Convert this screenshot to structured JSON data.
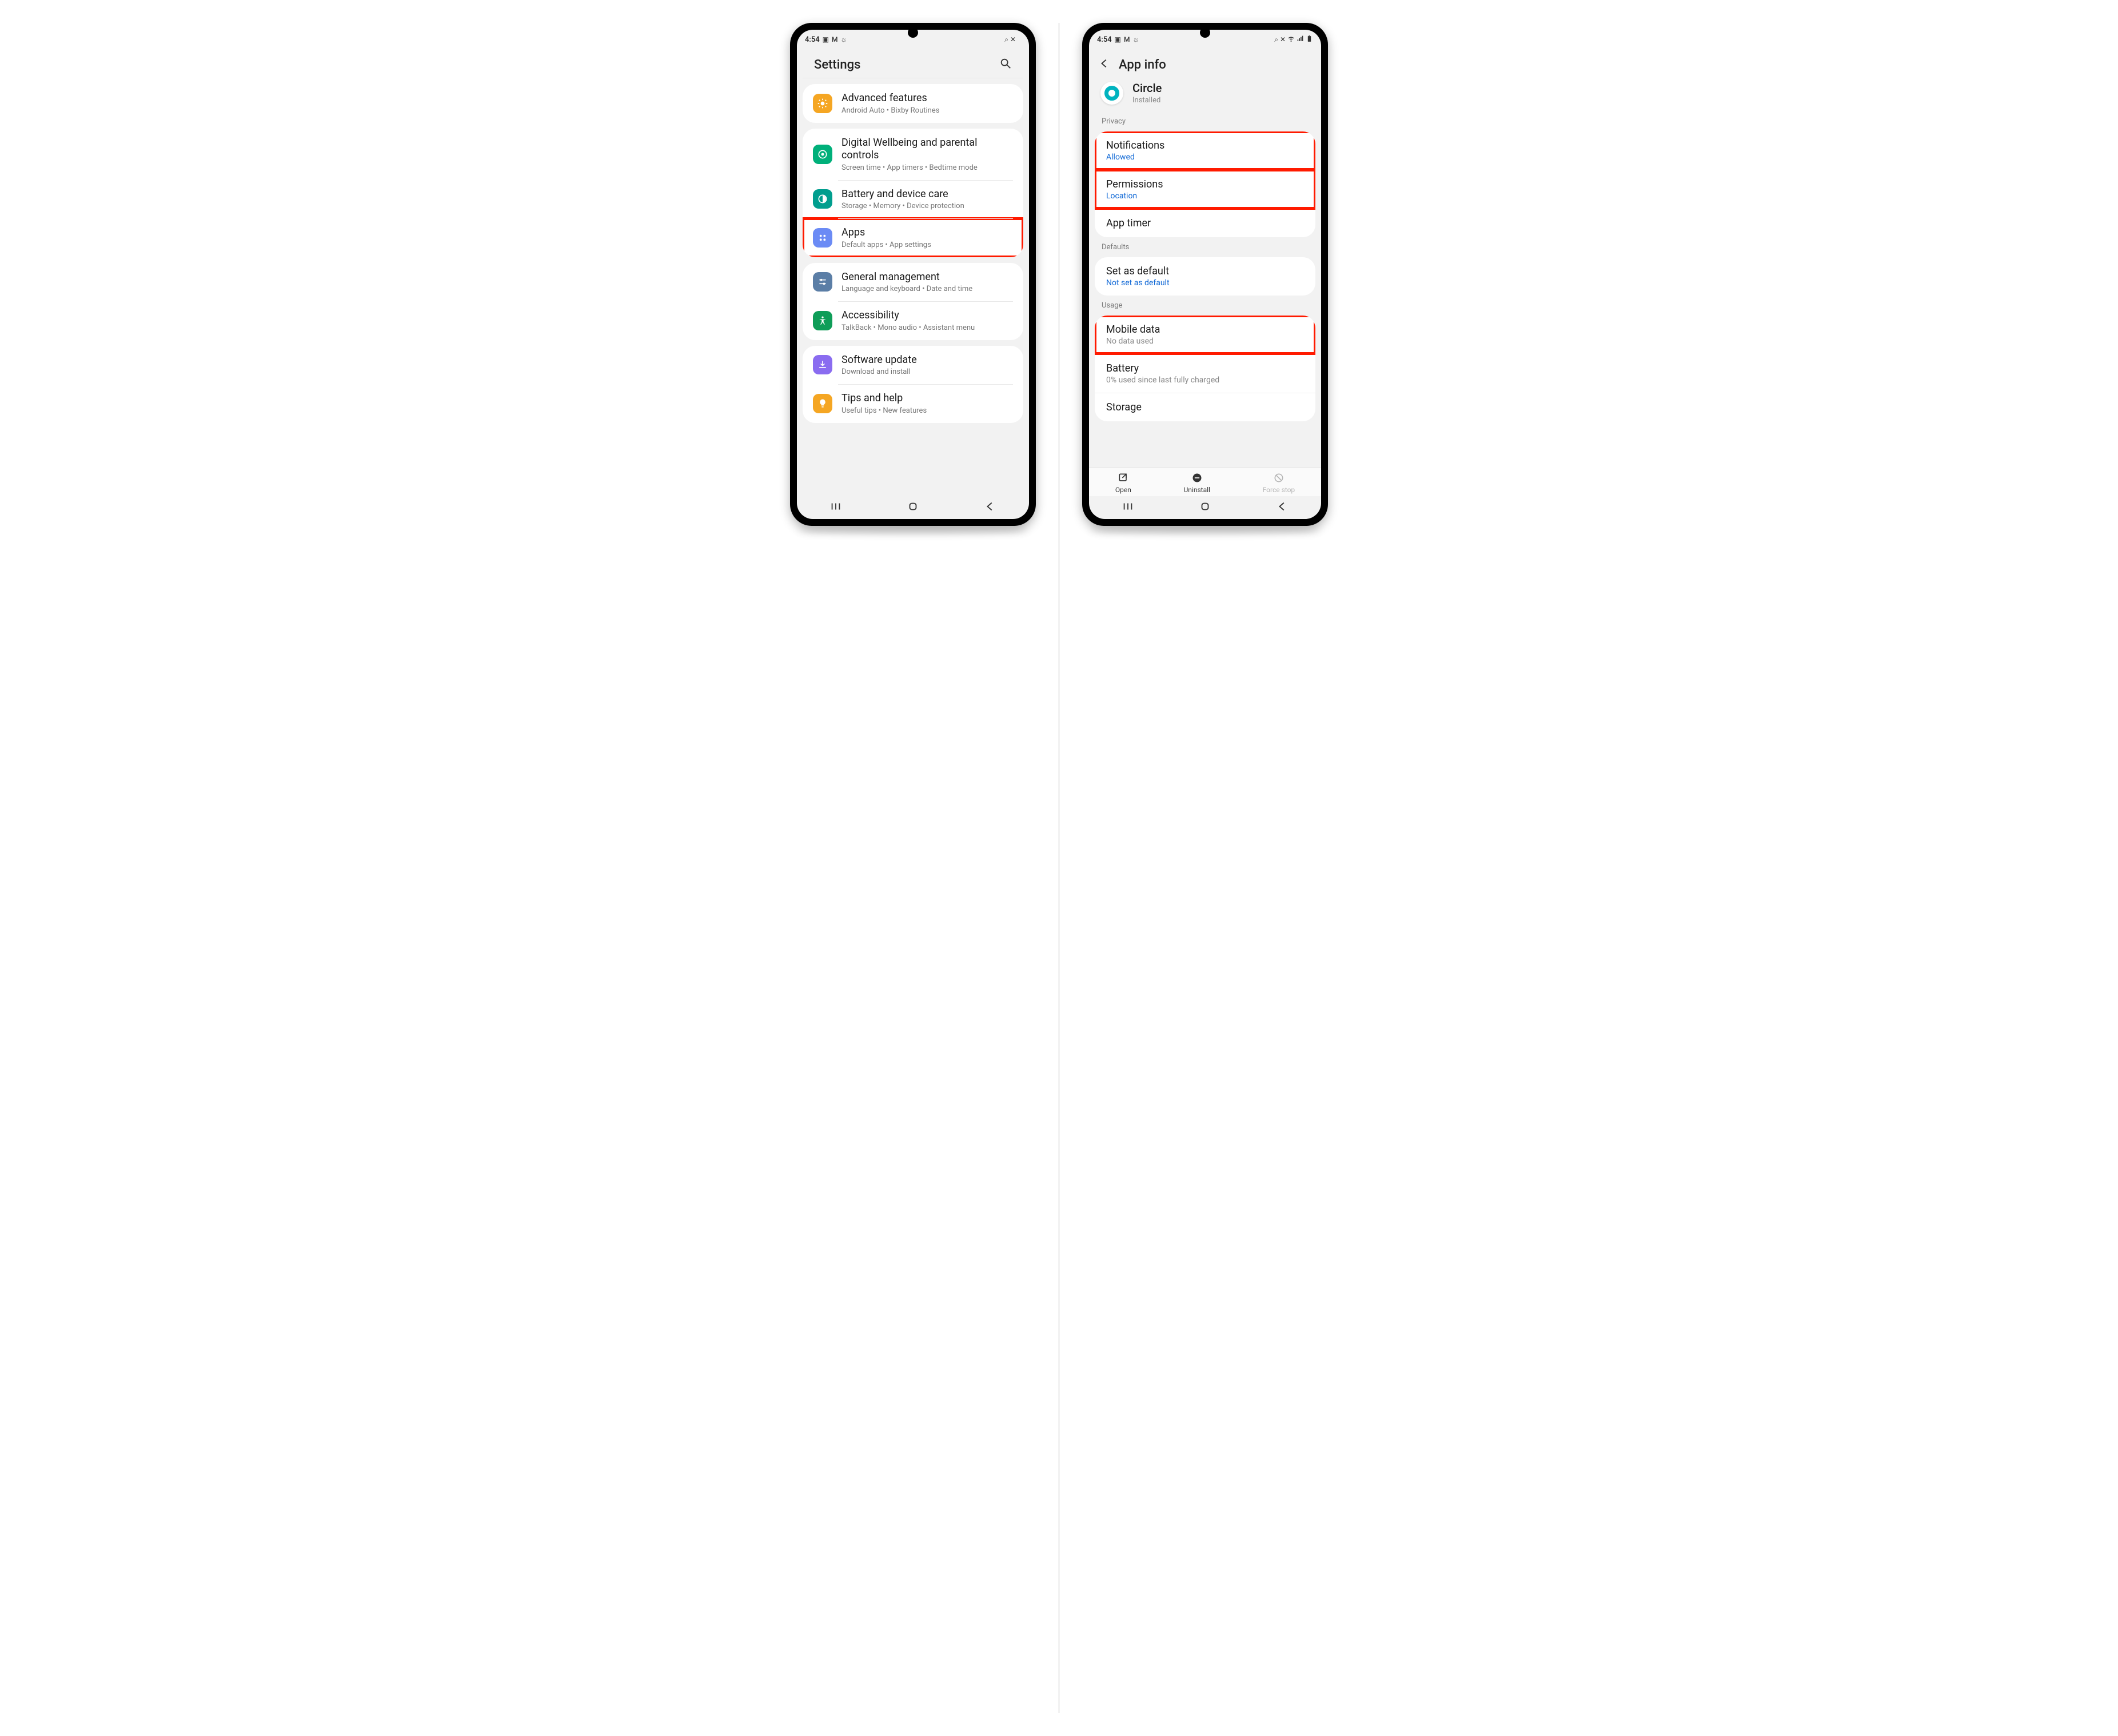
{
  "status": {
    "time": "4:54",
    "left_icons": [
      "image-icon",
      "gmail-icon",
      "weather-icon"
    ],
    "right_icons": [
      "vpn-key-icon",
      "vibrate-icon",
      "wifi-icon",
      "signal-icon",
      "battery-icon"
    ]
  },
  "left_phone": {
    "header_title": "Settings",
    "groups": [
      {
        "rows": [
          {
            "icon": "advanced-features-icon",
            "icon_bg": "#f5a623",
            "title": "Advanced features",
            "sub": "Android Auto  •  Bixby Routines"
          }
        ]
      },
      {
        "rows": [
          {
            "icon": "wellbeing-icon",
            "icon_bg": "#00b07a",
            "title": "Digital Wellbeing and parental controls",
            "sub": "Screen time  •  App timers  •  Bedtime mode"
          },
          {
            "icon": "battery-care-icon",
            "icon_bg": "#009e8e",
            "title": "Battery and device care",
            "sub": "Storage  •  Memory  •  Device protection"
          },
          {
            "icon": "apps-icon",
            "icon_bg": "#6b8bf5",
            "title": "Apps",
            "sub": "Default apps  •  App settings",
            "highlight": true
          }
        ]
      },
      {
        "rows": [
          {
            "icon": "general-icon",
            "icon_bg": "#5b7ea6",
            "title": "General management",
            "sub": "Language and keyboard  •  Date and time"
          },
          {
            "icon": "accessibility-icon",
            "icon_bg": "#0f9d58",
            "title": "Accessibility",
            "sub": "TalkBack  •  Mono audio  •  Assistant menu"
          }
        ]
      },
      {
        "rows": [
          {
            "icon": "software-update-icon",
            "icon_bg": "#8a6cf0",
            "title": "Software update",
            "sub": "Download and install"
          },
          {
            "icon": "tips-icon",
            "icon_bg": "#f5a623",
            "title": "Tips and help",
            "sub": "Useful tips  •  New features"
          }
        ]
      }
    ]
  },
  "right_phone": {
    "header_title": "App info",
    "app_name": "Circle",
    "app_status": "Installed",
    "sections": [
      {
        "label": "Privacy",
        "rows": [
          {
            "title": "Notifications",
            "sub": "Allowed",
            "sub_style": "blue",
            "highlight": true
          },
          {
            "title": "Permissions",
            "sub": "Location",
            "sub_style": "blue",
            "highlight": true
          },
          {
            "title": "App timer"
          }
        ]
      },
      {
        "label": "Defaults",
        "rows": [
          {
            "title": "Set as default",
            "sub": "Not set as default",
            "sub_style": "blue"
          }
        ]
      },
      {
        "label": "Usage",
        "rows": [
          {
            "title": "Mobile data",
            "sub": "No data used",
            "sub_style": "grey",
            "highlight": true
          },
          {
            "title": "Battery",
            "sub": "0% used since last fully charged",
            "sub_style": "grey"
          },
          {
            "title": "Storage"
          }
        ]
      }
    ],
    "bottom": {
      "open": "Open",
      "uninstall": "Uninstall",
      "forcestop": "Force stop"
    }
  }
}
